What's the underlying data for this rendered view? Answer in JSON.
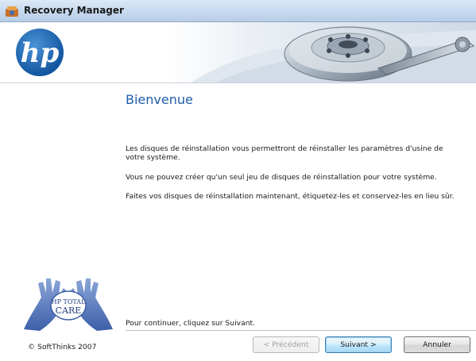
{
  "window": {
    "title": "Recovery Manager"
  },
  "banner": {
    "logo_text": "hp",
    "logo_icon": "hp-logo",
    "graphic_icon": "hard-drive-icon"
  },
  "content": {
    "heading": "Bienvenue",
    "paragraphs": [
      "Les disques de réinstallation vous permettront de réinstaller les paramètres d'usine de votre système.",
      "Vous ne pouvez créer qu'un seul jeu de disques de réinstallation pour votre système.",
      "Faites vos disques de réinstallation maintenant, étiquetez-les et conservez-les en lieu sûr."
    ],
    "continue_hint": "Pour continuer, cliquez sur Suivant."
  },
  "sidebar": {
    "care_logo_text_1": "HP TOTAL",
    "care_logo_text_2": "CARE"
  },
  "footer": {
    "copyright": "© SoftThinks 2007",
    "buttons": {
      "previous": "< Précédent",
      "next": "Suivant >",
      "cancel": "Annuler"
    }
  }
}
